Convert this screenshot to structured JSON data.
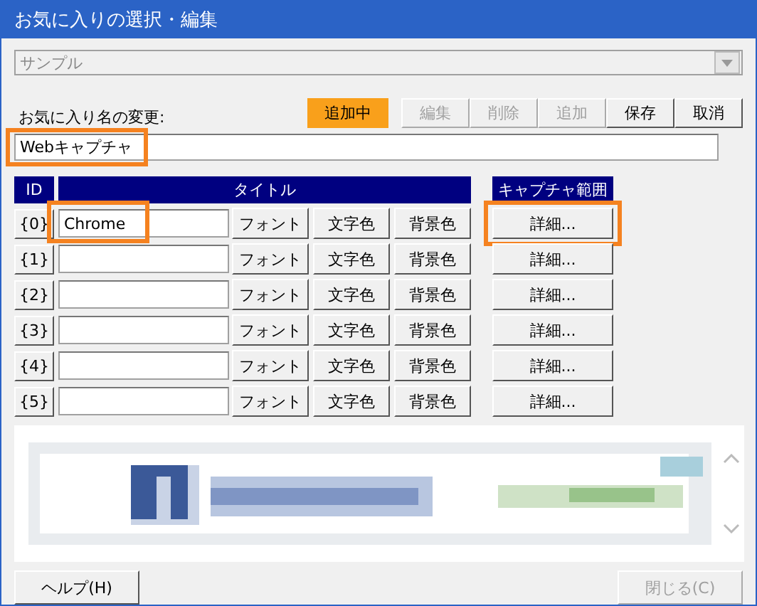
{
  "window": {
    "title": "お気に入りの選択・編集"
  },
  "favorite_select": {
    "value": "サンプル",
    "disabled": true
  },
  "rename_label": "お気に入り名の変更:",
  "toolbar": [
    {
      "label": "追加中",
      "kind": "status"
    },
    {
      "label": "編集",
      "kind": "button",
      "disabled": true
    },
    {
      "label": "削除",
      "kind": "button",
      "disabled": true
    },
    {
      "label": "追加",
      "kind": "button",
      "disabled": true
    },
    {
      "label": "保存",
      "kind": "button",
      "disabled": false
    },
    {
      "label": "取消",
      "kind": "button",
      "disabled": false
    }
  ],
  "name_field": {
    "value": "Webキャプチャ",
    "highlighted": true
  },
  "table": {
    "columns": [
      "ID",
      "タイトル",
      "キャプチャ範囲"
    ],
    "rows": [
      {
        "id": "{0}",
        "title": "Chrome",
        "title_highlighted": true,
        "buttons": [
          "フォント",
          "文字色",
          "背景色"
        ],
        "detail": "詳細...",
        "detail_highlighted": true
      },
      {
        "id": "{1}",
        "title_highlighted": false,
        "buttons": [
          "フォント",
          "文字色",
          "背景色"
        ],
        "detail": "詳細...",
        "detail_highlighted": false
      },
      {
        "id": "{2}",
        "title_highlighted": false,
        "buttons": [
          "フォント",
          "文字色",
          "背景色"
        ],
        "detail": "詳細...",
        "detail_highlighted": false
      },
      {
        "id": "{3}",
        "title_highlighted": false,
        "buttons": [
          "フォント",
          "文字色",
          "背景色"
        ],
        "detail": "詳細...",
        "detail_highlighted": false
      },
      {
        "id": "{4}",
        "title_highlighted": false,
        "buttons": [
          "フォント",
          "文字色",
          "背景色"
        ],
        "detail": "詳細...",
        "detail_highlighted": false
      },
      {
        "id": "{5}",
        "title_highlighted": false,
        "buttons": [
          "フォント",
          "文字色",
          "背景色"
        ],
        "detail": "詳細...",
        "detail_highlighted": false
      }
    ]
  },
  "footer": [
    {
      "label": "ヘルプ(H)",
      "disabled": false
    },
    {
      "label": "閉じる(C)",
      "disabled": true
    }
  ]
}
